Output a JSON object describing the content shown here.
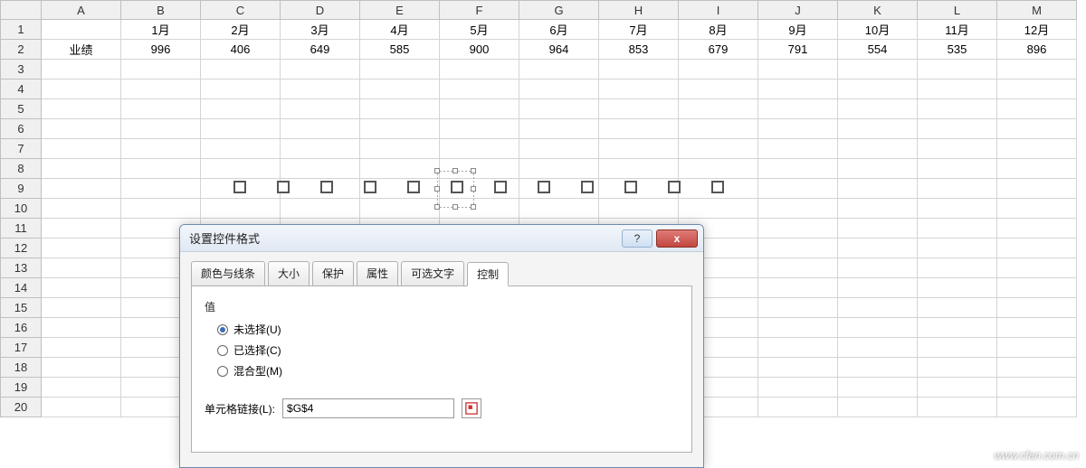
{
  "columns": [
    "A",
    "B",
    "C",
    "D",
    "E",
    "F",
    "G",
    "H",
    "I",
    "J",
    "K",
    "L",
    "M"
  ],
  "row_numbers": [
    "1",
    "2",
    "3",
    "4",
    "5",
    "6",
    "7",
    "8",
    "9",
    "10",
    "11",
    "12",
    "13",
    "14",
    "15",
    "16",
    "17",
    "18",
    "19",
    "20"
  ],
  "grid": {
    "r1": {
      "A": "",
      "B": "1月",
      "C": "2月",
      "D": "3月",
      "E": "4月",
      "F": "5月",
      "G": "6月",
      "H": "7月",
      "I": "8月",
      "J": "9月",
      "K": "10月",
      "L": "11月",
      "M": "12月"
    },
    "r2": {
      "A": "业绩",
      "B": "996",
      "C": "406",
      "D": "649",
      "E": "585",
      "F": "900",
      "G": "964",
      "H": "853",
      "I": "679",
      "J": "791",
      "K": "554",
      "L": "535",
      "M": "896"
    }
  },
  "dialog": {
    "title": "设置控件格式",
    "help_label": "?",
    "close_label": "x",
    "tabs": {
      "color_line": "颜色与线条",
      "size": "大小",
      "protect": "保护",
      "properties": "属性",
      "alt_text": "可选文字",
      "control": "控制"
    },
    "fieldset_value": "值",
    "radios": {
      "unselected": "未选择(U)",
      "selected": "已选择(C)",
      "mixed": "混合型(M)"
    },
    "cell_link_label": "单元格链接(L):",
    "cell_link_value": "$G$4"
  },
  "watermark": "www.cfan.com.cn"
}
